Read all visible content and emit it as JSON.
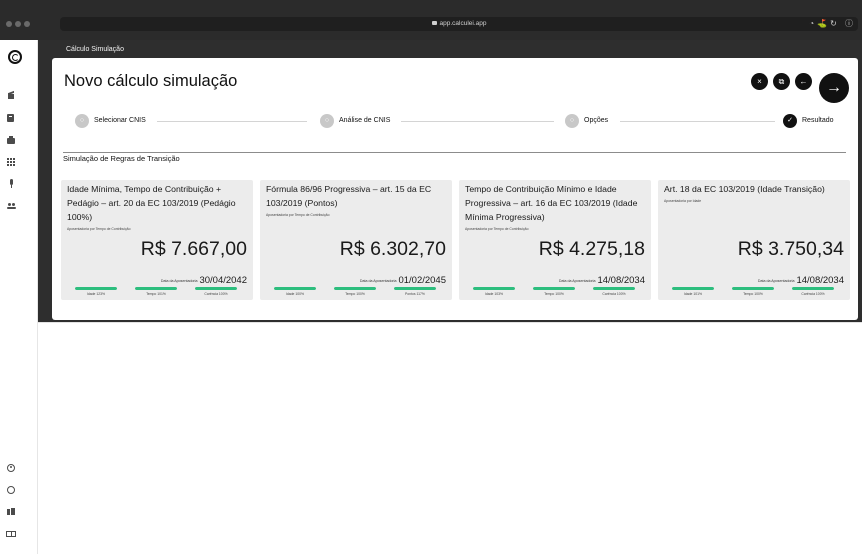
{
  "browser": {
    "url": "app.calculei.app",
    "right_icons": "◔⛳↻ ⓘ"
  },
  "sidebar": {
    "top_icons": [
      "home-icon",
      "document-icon",
      "briefcase-icon",
      "grid-icon",
      "microphone-icon",
      "users-icon"
    ],
    "bottom_icons": [
      "user-circle-icon",
      "whatsapp-icon",
      "team-icon",
      "book-icon"
    ]
  },
  "header": {
    "section": "Cálculo Simulação",
    "title": "Novo cálculo simulação"
  },
  "actions": {
    "close": "×",
    "copy": "⧉",
    "back": "←",
    "next": "→"
  },
  "stepper": [
    {
      "label": "Selecionar CNIS",
      "status": "pending",
      "icon": "○"
    },
    {
      "label": "Análise de CNIS",
      "status": "pending",
      "icon": "○"
    },
    {
      "label": "Opções",
      "status": "pending",
      "icon": "○"
    },
    {
      "label": "Resultado",
      "status": "done",
      "icon": "✓"
    }
  ],
  "section_title": "Simulação de Regras de Transição",
  "colors": {
    "accent": "#2dbe7e",
    "dark": "#111111",
    "card_bg": "#ececec"
  },
  "cards": [
    {
      "title": "Idade Mínima, Tempo de Contribuição + Pedágio – art. 20 da EC 103/2019 (Pedágio 100%)",
      "type": "Aposentadoria por Tempo de Contribuição",
      "value": "R$ 7.667,00",
      "date_label": "Data da Aposentadoria",
      "date": "30/04/2042",
      "bars": [
        {
          "label": "Idade 123%",
          "fill": 100
        },
        {
          "label": "Tempo 101%",
          "fill": 100
        },
        {
          "label": "Carência 100%",
          "fill": 100
        }
      ]
    },
    {
      "title": "Fórmula 86/96 Progressiva – art. 15 da EC 103/2019 (Pontos)",
      "type": "Aposentadoria por Tempo de Contribuição",
      "value": "R$ 6.302,70",
      "date_label": "Data da Aposentadoria",
      "date": "01/02/2045",
      "bars": [
        {
          "label": "Idade 100%",
          "fill": 100
        },
        {
          "label": "Tempo 100%",
          "fill": 100
        },
        {
          "label": "Pontos 117%",
          "fill": 100
        }
      ]
    },
    {
      "title": "Tempo de Contribuição Mínimo e Idade Progressiva – art. 16 da EC 103/2019 (Idade Mínima Progressiva)",
      "type": "Aposentadoria por Tempo de Contribuição",
      "value": "R$ 4.275,18",
      "date_label": "Data da Aposentadoria",
      "date": "14/08/2034",
      "bars": [
        {
          "label": "Idade 103%",
          "fill": 100
        },
        {
          "label": "Tempo 100%",
          "fill": 100
        },
        {
          "label": "Carência 100%",
          "fill": 100
        }
      ]
    },
    {
      "title": "Art. 18 da EC 103/2019 (Idade Transição)",
      "type": "Aposentadoria por Idade",
      "value": "R$ 3.750,34",
      "date_label": "Data da Aposentadoria",
      "date": "14/08/2034",
      "bars": [
        {
          "label": "Idade 101%",
          "fill": 100
        },
        {
          "label": "Tempo 100%",
          "fill": 100
        },
        {
          "label": "Carência 100%",
          "fill": 100
        }
      ]
    }
  ]
}
